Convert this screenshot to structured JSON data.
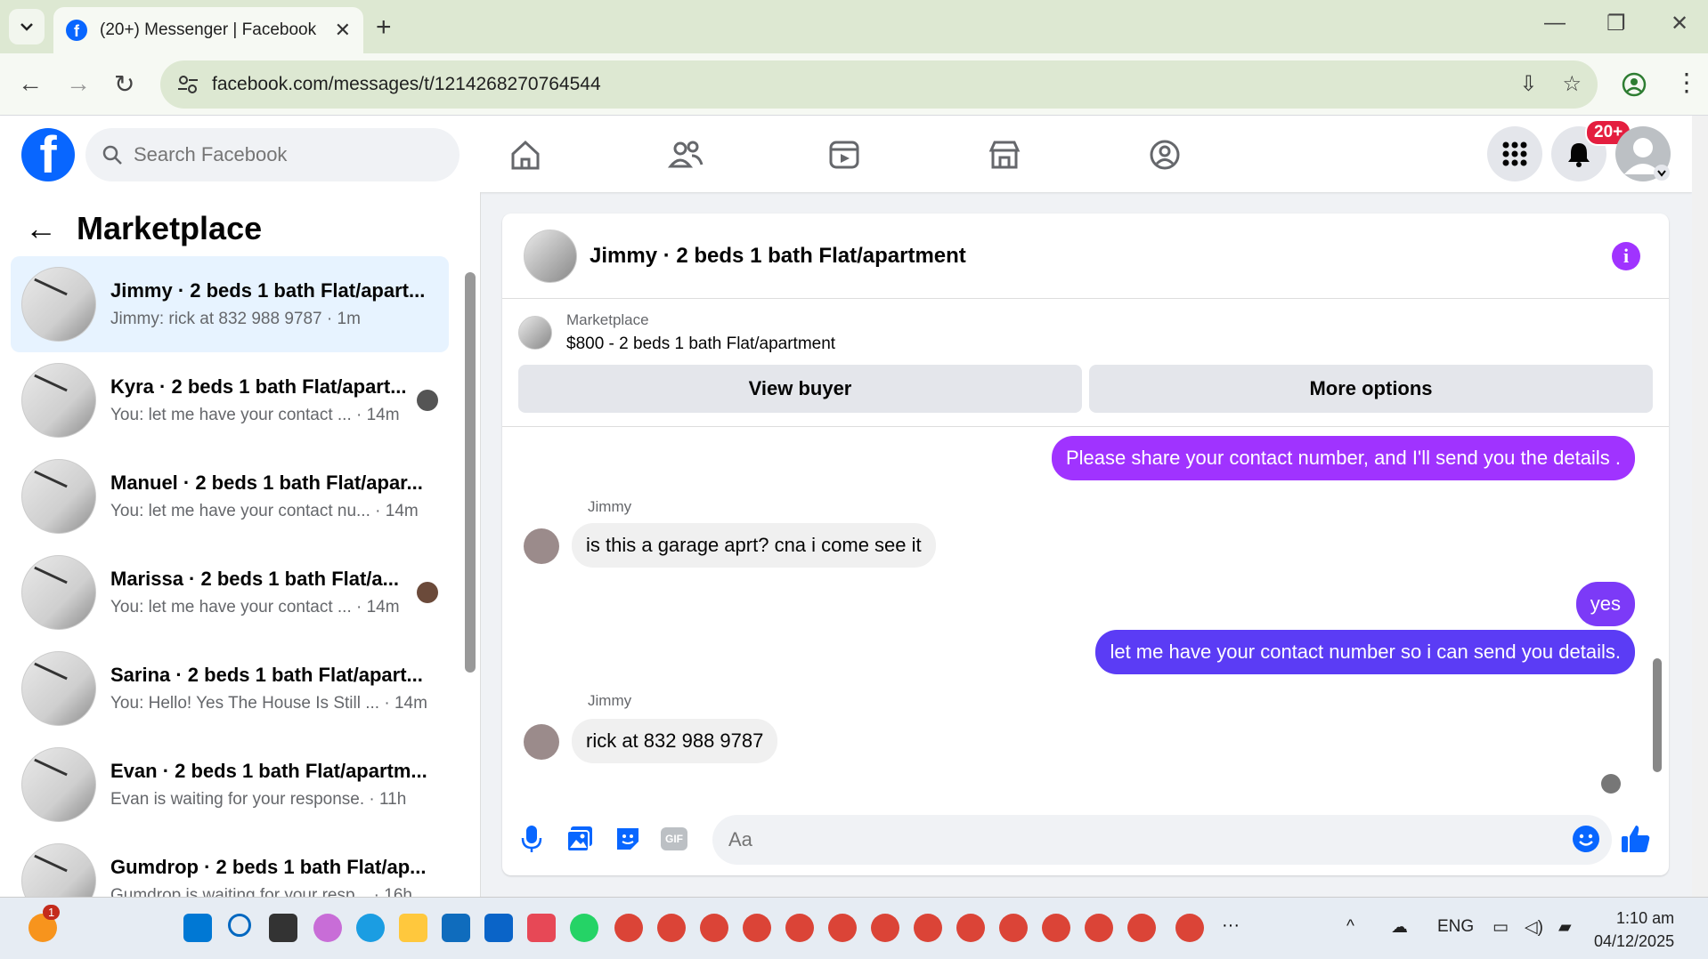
{
  "browser": {
    "tab_title": "(20+) Messenger | Facebook",
    "url": "facebook.com/messages/t/1214268270764544",
    "new_tab_label": "+"
  },
  "fb": {
    "logo": "f",
    "search_placeholder": "Search Facebook",
    "notification_badge": "20+"
  },
  "sidebar": {
    "title": "Marketplace",
    "conversations": [
      {
        "name": "Jimmy · 2 beds 1 bath Flat/apart...",
        "preview": "Jimmy: rick at 832 988 9787 · 1m"
      },
      {
        "name": "Kyra · 2 beds 1 bath Flat/apart...",
        "preview": "You: let me have your contact ... · 14m"
      },
      {
        "name": "Manuel · 2 beds 1 bath Flat/apar...",
        "preview": "You: let me have your contact nu... · 14m"
      },
      {
        "name": "Marissa · 2 beds 1 bath Flat/a...",
        "preview": "You: let me have your contact ... · 14m"
      },
      {
        "name": "Sarina · 2 beds 1 bath Flat/apart...",
        "preview": "You: Hello! Yes The House Is Still ... · 14m"
      },
      {
        "name": "Evan · 2 beds 1 bath Flat/apartm...",
        "preview": "Evan is waiting for your response. · 11h"
      },
      {
        "name": "Gumdrop · 2 beds 1 bath Flat/ap...",
        "preview": "Gumdrop is waiting for your resp... · 16h"
      }
    ]
  },
  "chat": {
    "title": "Jimmy · 2 beds 1 bath Flat/apartment",
    "listing_label": "Marketplace",
    "listing_value": "$800 - 2 beds 1 bath Flat/apartment",
    "view_buyer": "View buyer",
    "more_options": "More options",
    "messages": [
      {
        "text": "Please share your contact number, and I'll send you the details ."
      },
      {
        "sender": "Jimmy",
        "text": "is this a garage aprt? cna i come see it"
      },
      {
        "text": "yes"
      },
      {
        "text": "let me have your contact number so i can send you details."
      },
      {
        "sender": "Jimmy",
        "text": "rick at 832 988 9787"
      }
    ],
    "composer_placeholder": "Aa",
    "gif_label": "GIF"
  },
  "taskbar": {
    "notif_count": "1",
    "lang": "ENG",
    "time": "1:10 am",
    "date": "04/12/2025",
    "more": "···"
  },
  "colors": {
    "fb_blue": "#0866ff",
    "out_bubble_top": "#a033ff",
    "out_bubble_bottom": "#5b3cf5",
    "badge_red": "#e41e3f"
  }
}
